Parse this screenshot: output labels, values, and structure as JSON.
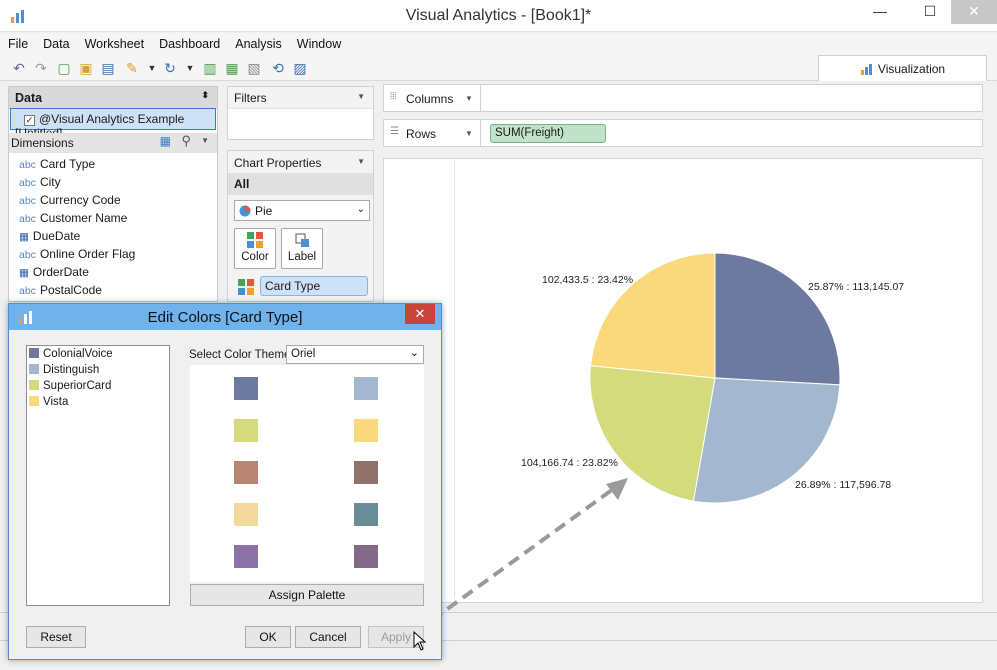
{
  "window": {
    "title": "Visual Analytics - [Book1]*",
    "minimize": "—",
    "maximize": "☐",
    "close": "✕"
  },
  "menu": [
    "File",
    "Data",
    "Worksheet",
    "Dashboard",
    "Analysis",
    "Window"
  ],
  "visualization_tab": "Visualization",
  "data_panel": {
    "header": "Data",
    "source": "@Visual Analytics Example [Untitled]",
    "dimensions_label": "Dimensions",
    "dimensions": [
      {
        "icon": "abc",
        "label": "Card Type"
      },
      {
        "icon": "abc",
        "label": "City"
      },
      {
        "icon": "abc",
        "label": "Currency Code"
      },
      {
        "icon": "abc",
        "label": "Customer Name"
      },
      {
        "icon": "date",
        "label": "DueDate"
      },
      {
        "icon": "abc",
        "label": "Online Order Flag"
      },
      {
        "icon": "date",
        "label": "OrderDate"
      },
      {
        "icon": "abc",
        "label": "PostalCode"
      }
    ]
  },
  "filters": {
    "header": "Filters"
  },
  "chart_properties": {
    "header": "Chart Properties",
    "scope": "All",
    "chart_type": "Pie",
    "color_btn": "Color",
    "label_btn": "Label",
    "color_field": "Card Type"
  },
  "shelves": {
    "columns_label": "Columns",
    "rows_label": "Rows",
    "rows_pill": "SUM(Freight)"
  },
  "chart_data": {
    "type": "pie",
    "slices": [
      {
        "name": "ColonialVoice",
        "value": 113145.07,
        "percent": 25.87,
        "label": "25.87% : 113,145.07",
        "color": "#6d799f"
      },
      {
        "name": "Distinguish",
        "value": 117596.78,
        "percent": 26.89,
        "label": "26.89% : 117,596.78",
        "color": "#a3b8ce"
      },
      {
        "name": "SuperiorCard",
        "value": 104166.74,
        "percent": 23.82,
        "label": "104,166.74 : 23.82%",
        "color": "#d4db7c"
      },
      {
        "name": "Vista",
        "value": 102433.5,
        "percent": 23.42,
        "label": "102,433.5 : 23.42%",
        "color": "#fad97d"
      }
    ]
  },
  "dialog": {
    "title": "Edit Colors [Card Type]",
    "legend": [
      {
        "label": "ColonialVoice",
        "color": "#6d799f"
      },
      {
        "label": "Distinguish",
        "color": "#a3b8ce"
      },
      {
        "label": "SuperiorCard",
        "color": "#d4db7c"
      },
      {
        "label": "Vista",
        "color": "#fad97d"
      }
    ],
    "theme_label": "Select Color Theme:",
    "theme_value": "Oriel",
    "palette": [
      "#6d799f",
      "#a3b8ce",
      "#d4db7c",
      "#fad97d",
      "#b98573",
      "#8f736a",
      "#f2d99e",
      "#698d96",
      "#8b73a8",
      "#806a87"
    ],
    "assign_btn": "Assign Palette",
    "reset_btn": "Reset",
    "ok_btn": "OK",
    "cancel_btn": "Cancel",
    "apply_btn": "Apply"
  }
}
